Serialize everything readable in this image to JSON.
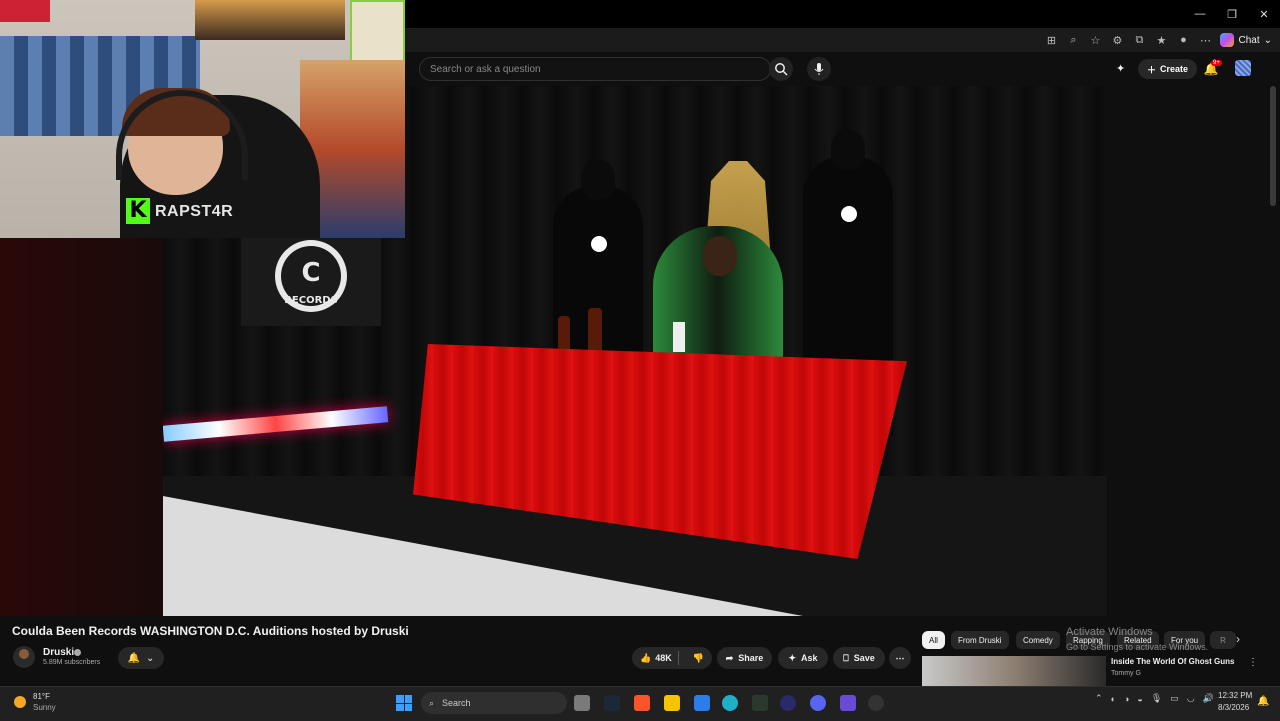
{
  "browser": {
    "window_controls": [
      "—",
      "❐",
      "✕"
    ],
    "chat_label": "Chat"
  },
  "youtube": {
    "search_placeholder": "Search or ask a question",
    "create_label": "Create",
    "notification_count": "9+"
  },
  "webcam": {
    "streamer_name": "RAPST4R",
    "kick_logo": "K"
  },
  "video": {
    "title": "Coulda Been Records WASHINGTON D.C. Auditions hosted by Druski",
    "channel_name": "Druski",
    "subscribers": "5.89M subscribers",
    "likes": "48K",
    "share_label": "Share",
    "ask_label": "Ask",
    "save_label": "Save",
    "sign_text": "RECORDS"
  },
  "chips": [
    "All",
    "From Druski",
    "Comedy",
    "Rapping",
    "Related",
    "For you",
    "R"
  ],
  "watermark": {
    "line1": "Activate Windows",
    "line2": "Go to Settings to activate Windows."
  },
  "recommended": {
    "title": "Inside The World Of Ghost Guns",
    "channel": "Tommy G"
  },
  "taskbar": {
    "weather_temp": "81°F",
    "weather_condition": "Sunny",
    "search_label": "Search",
    "time": "12:32 PM",
    "date": "8/3/2026"
  },
  "colors": {
    "accent_kick": "#53fc18",
    "notification_red": "#e00000",
    "table_red": "#d80d0d"
  }
}
